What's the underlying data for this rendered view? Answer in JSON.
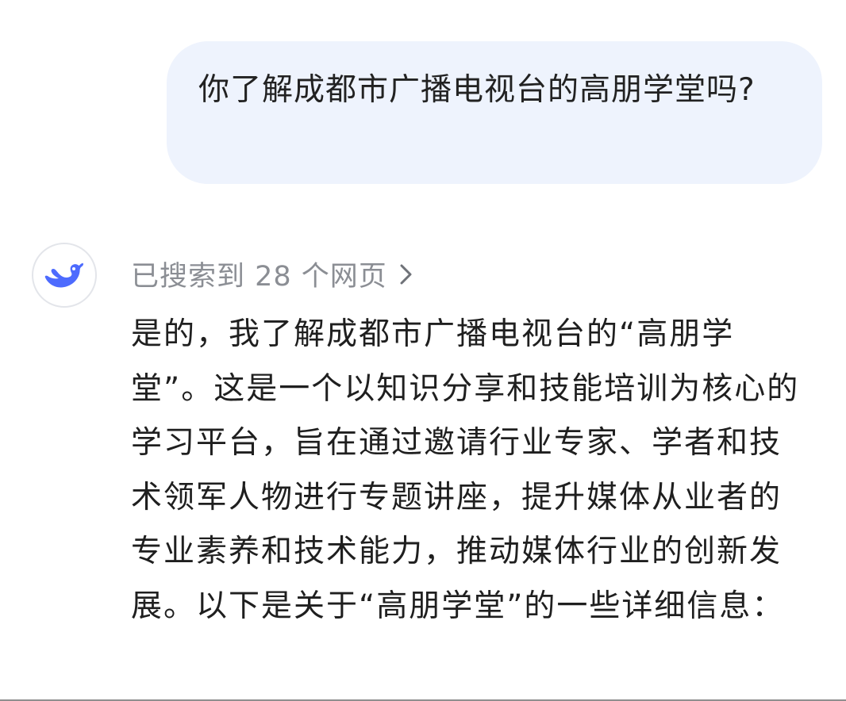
{
  "user_message": {
    "text": "你了解成都市广播电视台的高朋学堂吗?"
  },
  "assistant": {
    "avatar_icon": "deepseek-whale-icon",
    "search_status": {
      "label": "已搜索到 28 个网页",
      "icon": "chevron-right-icon"
    },
    "answer_text": "是的，我了解成都市广播电视台的“高朋学堂”。这是一个以知识分享和技能培训为核心的学习平台，旨在通过邀请行业专家、学者和技术领军人物进行专题讲座，提升媒体从业者的专业素养和技术能力，推动媒体行业的创新发展。以下是关于“高朋学堂”的一些详细信息："
  },
  "colors": {
    "user_bubble_bg": "#eef3fd",
    "brand_blue": "#4d6bfe",
    "muted_text": "#8b8e94"
  }
}
